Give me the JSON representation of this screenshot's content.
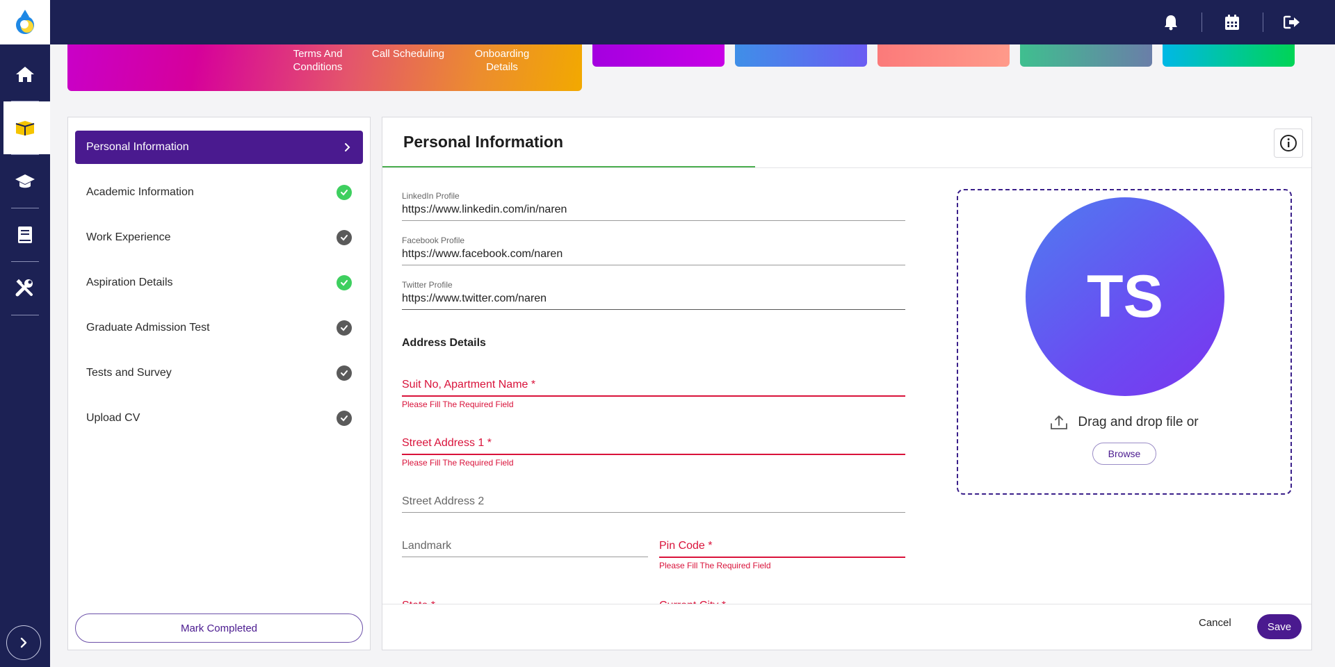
{
  "colors": {
    "sidebar": "#1c2154",
    "accent": "#4a1a8f",
    "error": "#d9123a",
    "success": "#3ecf5f"
  },
  "sidebar": {
    "items": [
      {
        "icon": "home-icon"
      },
      {
        "icon": "box-icon",
        "active": true
      },
      {
        "icon": "graduation-cap-icon"
      },
      {
        "icon": "book-icon"
      },
      {
        "icon": "tools-icon"
      }
    ],
    "expand_icon": "chevron-right-icon"
  },
  "header": {
    "icons": [
      "bell-icon",
      "calendar-icon",
      "logout-icon"
    ]
  },
  "banner": {
    "steps": [
      {
        "label": "Terms And\nConditions"
      },
      {
        "label": "Call Scheduling"
      },
      {
        "label": "Onboarding\nDetails"
      }
    ]
  },
  "steps": {
    "items": [
      {
        "label": "Personal Information",
        "status": "active"
      },
      {
        "label": "Academic Information",
        "status": "done"
      },
      {
        "label": "Work Experience",
        "status": "pending"
      },
      {
        "label": "Aspiration Details",
        "status": "done"
      },
      {
        "label": "Graduate Admission Test",
        "status": "pending"
      },
      {
        "label": "Tests and Survey",
        "status": "pending"
      },
      {
        "label": "Upload CV",
        "status": "pending"
      }
    ],
    "mark_completed": "Mark Completed"
  },
  "form": {
    "title": "Personal Information",
    "linkedin": {
      "label": "LinkedIn Profile",
      "value": "https://www.linkedin.com/in/naren"
    },
    "facebook": {
      "label": "Facebook Profile",
      "value": "https://www.facebook.com/naren"
    },
    "twitter": {
      "label": "Twitter Profile",
      "value": "https://www.twitter.com/naren"
    },
    "address_heading": "Address Details",
    "suit": {
      "placeholder": "Suit No, Apartment Name *",
      "error": "Please Fill The Required Field"
    },
    "street1": {
      "placeholder": "Street Address 1 *",
      "error": "Please Fill The Required Field"
    },
    "street2": {
      "placeholder": "Street Address 2"
    },
    "landmark": {
      "placeholder": "Landmark"
    },
    "pincode": {
      "placeholder": "Pin Code *",
      "error": "Please Fill The Required Field"
    },
    "state_cut": "State *",
    "city_cut": "Current City *",
    "cancel": "Cancel",
    "save": "Save"
  },
  "upload": {
    "initials": "TS",
    "drag_text": "Drag and drop file or",
    "browse": "Browse"
  }
}
